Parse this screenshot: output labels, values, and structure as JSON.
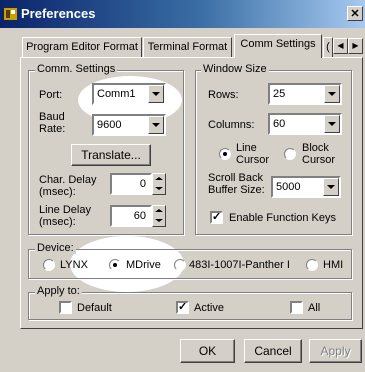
{
  "window": {
    "title": "Preferences",
    "close_glyph": "✕"
  },
  "tabs": [
    {
      "label": "Program Editor Format",
      "active": false
    },
    {
      "label": "Terminal Format",
      "active": false
    },
    {
      "label": "Comm Settings",
      "active": true
    },
    {
      "label": "(",
      "active": false
    }
  ],
  "tab_scroll": {
    "left_glyph": "◀",
    "right_glyph": "▶"
  },
  "comm_settings": {
    "legend": "Comm. Settings",
    "port_label": "Port:",
    "port_value": "Comm1",
    "baud_label": "Baud\nRate:",
    "baud_value": "9600",
    "translate_button": "Translate...",
    "char_delay_label": "Char. Delay\n(msec):",
    "char_delay_value": "0",
    "line_delay_label": "Line Delay\n(msec):",
    "line_delay_value": "60"
  },
  "window_size": {
    "legend": "Window Size",
    "rows_label": "Rows:",
    "rows_value": "25",
    "columns_label": "Columns:",
    "columns_value": "60",
    "line_cursor_label": "Line\nCursor",
    "block_cursor_label": "Block\nCursor",
    "cursor_selected": "line",
    "scroll_back_label": "Scroll Back\nBuffer Size:",
    "scroll_back_value": "5000",
    "enable_function_keys_label": "Enable Function Keys",
    "enable_function_keys_checked": true
  },
  "device": {
    "legend": "Device:",
    "options": [
      "LYNX",
      "MDrive",
      "483I-1007I-Panther I",
      "HMI"
    ],
    "selected": "MDrive"
  },
  "apply_to": {
    "legend": "Apply to:",
    "default_label": "Default",
    "default_checked": false,
    "active_label": "Active",
    "active_checked": true,
    "all_label": "All",
    "all_checked": false
  },
  "buttons": {
    "ok": "OK",
    "cancel": "Cancel",
    "apply": "Apply"
  },
  "colors": {
    "face": "#d4d0c8",
    "title_start": "#0a246a",
    "title_end": "#a6caf0",
    "highlight": "#ffffff"
  },
  "icons": {
    "app": "preferences-app-icon",
    "close": "close-icon",
    "check": "checkmark-icon",
    "dropdown": "chevron-down-icon"
  }
}
